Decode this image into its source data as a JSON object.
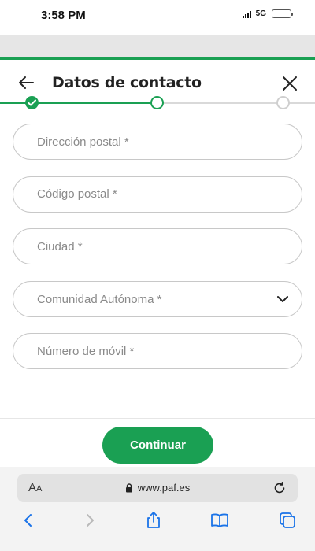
{
  "status": {
    "time": "3:58 PM",
    "network": "5G"
  },
  "header": {
    "title": "Datos de contacto"
  },
  "stepper": {
    "total_steps": 3,
    "completed_steps": 1,
    "current_step": 2
  },
  "form": {
    "postal_address_placeholder": "Dirección postal *",
    "postal_code_placeholder": "Código postal *",
    "city_placeholder": "Ciudad *",
    "region_label": "Comunidad Autónoma *",
    "mobile_placeholder": "Número de móvil *"
  },
  "actions": {
    "continue_label": "Continuar"
  },
  "browser": {
    "url": "www.paf.es",
    "text_size_label_big": "A",
    "text_size_label_small": "A"
  },
  "colors": {
    "accent": "#1aa053",
    "field_border": "#c8c8c8",
    "placeholder": "#8a8a8a",
    "browser_blue": "#1a73e8"
  },
  "icons": [
    "back-arrow-icon",
    "close-icon",
    "check-icon",
    "chevron-down-icon",
    "lock-icon",
    "reload-icon",
    "nav-back-icon",
    "nav-forward-icon",
    "share-icon",
    "bookmarks-icon",
    "tabs-icon"
  ]
}
